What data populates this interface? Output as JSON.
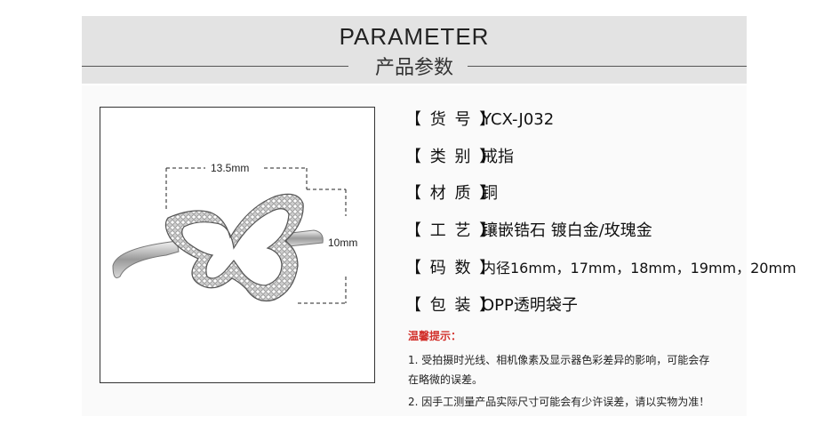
{
  "header": {
    "title_en": "PARAMETER",
    "title_cn": "产品参数"
  },
  "photo": {
    "width_label": "13.5mm",
    "height_label": "10mm"
  },
  "params": [
    {
      "label": "【 货 号 】",
      "value": "YCX-J032"
    },
    {
      "label": "【 类 别 】",
      "value": "戒指"
    },
    {
      "label": "【 材 质 】",
      "value": "铜"
    },
    {
      "label": "【 工 艺 】",
      "value": "镶嵌锆石 镀白金/玫瑰金"
    },
    {
      "label": "【 码 数 】",
      "value": "内径16mm，17mm，18mm，19mm，20mm"
    },
    {
      "label": "【 包 装 】",
      "value": "OPP透明袋子"
    }
  ],
  "tips": {
    "title": "温馨提示：",
    "line1": "1. 受拍摄时光线、相机像素及显示器色彩差异的影响，可能会存",
    "line1b": "在略微的误差。",
    "line2": "2. 因手工测量产品实际尺寸可能会有少许误差，请以实物为准！"
  },
  "colors": {
    "header_bg": "#e3e3e3",
    "tip_title": "#d2312c"
  }
}
